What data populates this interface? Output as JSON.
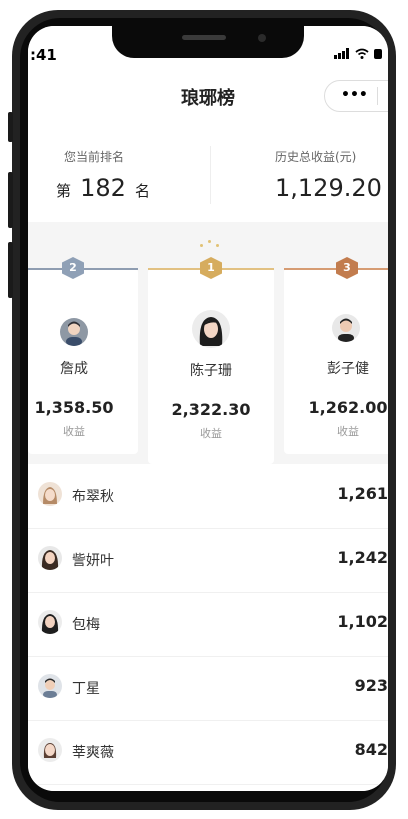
{
  "status_bar": {
    "time": ":41",
    "icons": "signal-icon wifi-icon battery-icon"
  },
  "navbar": {
    "title": "琅琊榜",
    "more_dots": "•••"
  },
  "summary": {
    "rank_label": "您当前排名",
    "rank_prefix": "第",
    "rank_value": "182",
    "rank_suffix": "名",
    "earnings_label": "历史总收益(元)",
    "earnings_value": "1,129.20"
  },
  "podium": [
    {
      "rank": "2",
      "name": "詹成",
      "value": "1,358.50",
      "value_label": "收益",
      "color": "#7e8fa6"
    },
    {
      "rank": "1",
      "name": "陈子珊",
      "value": "2,322.30",
      "value_label": "收益",
      "color": "#d6ac5e"
    },
    {
      "rank": "3",
      "name": "彭子健",
      "value": "1,262.00",
      "value_label": "收益",
      "color": "#c27c4e"
    }
  ],
  "list": [
    {
      "name": "布翠秋",
      "value": "1,261"
    },
    {
      "name": "訾妍叶",
      "value": "1,242"
    },
    {
      "name": "包梅",
      "value": "1,102"
    },
    {
      "name": "丁星",
      "value": "923"
    },
    {
      "name": "莘爽薇",
      "value": "842"
    }
  ]
}
